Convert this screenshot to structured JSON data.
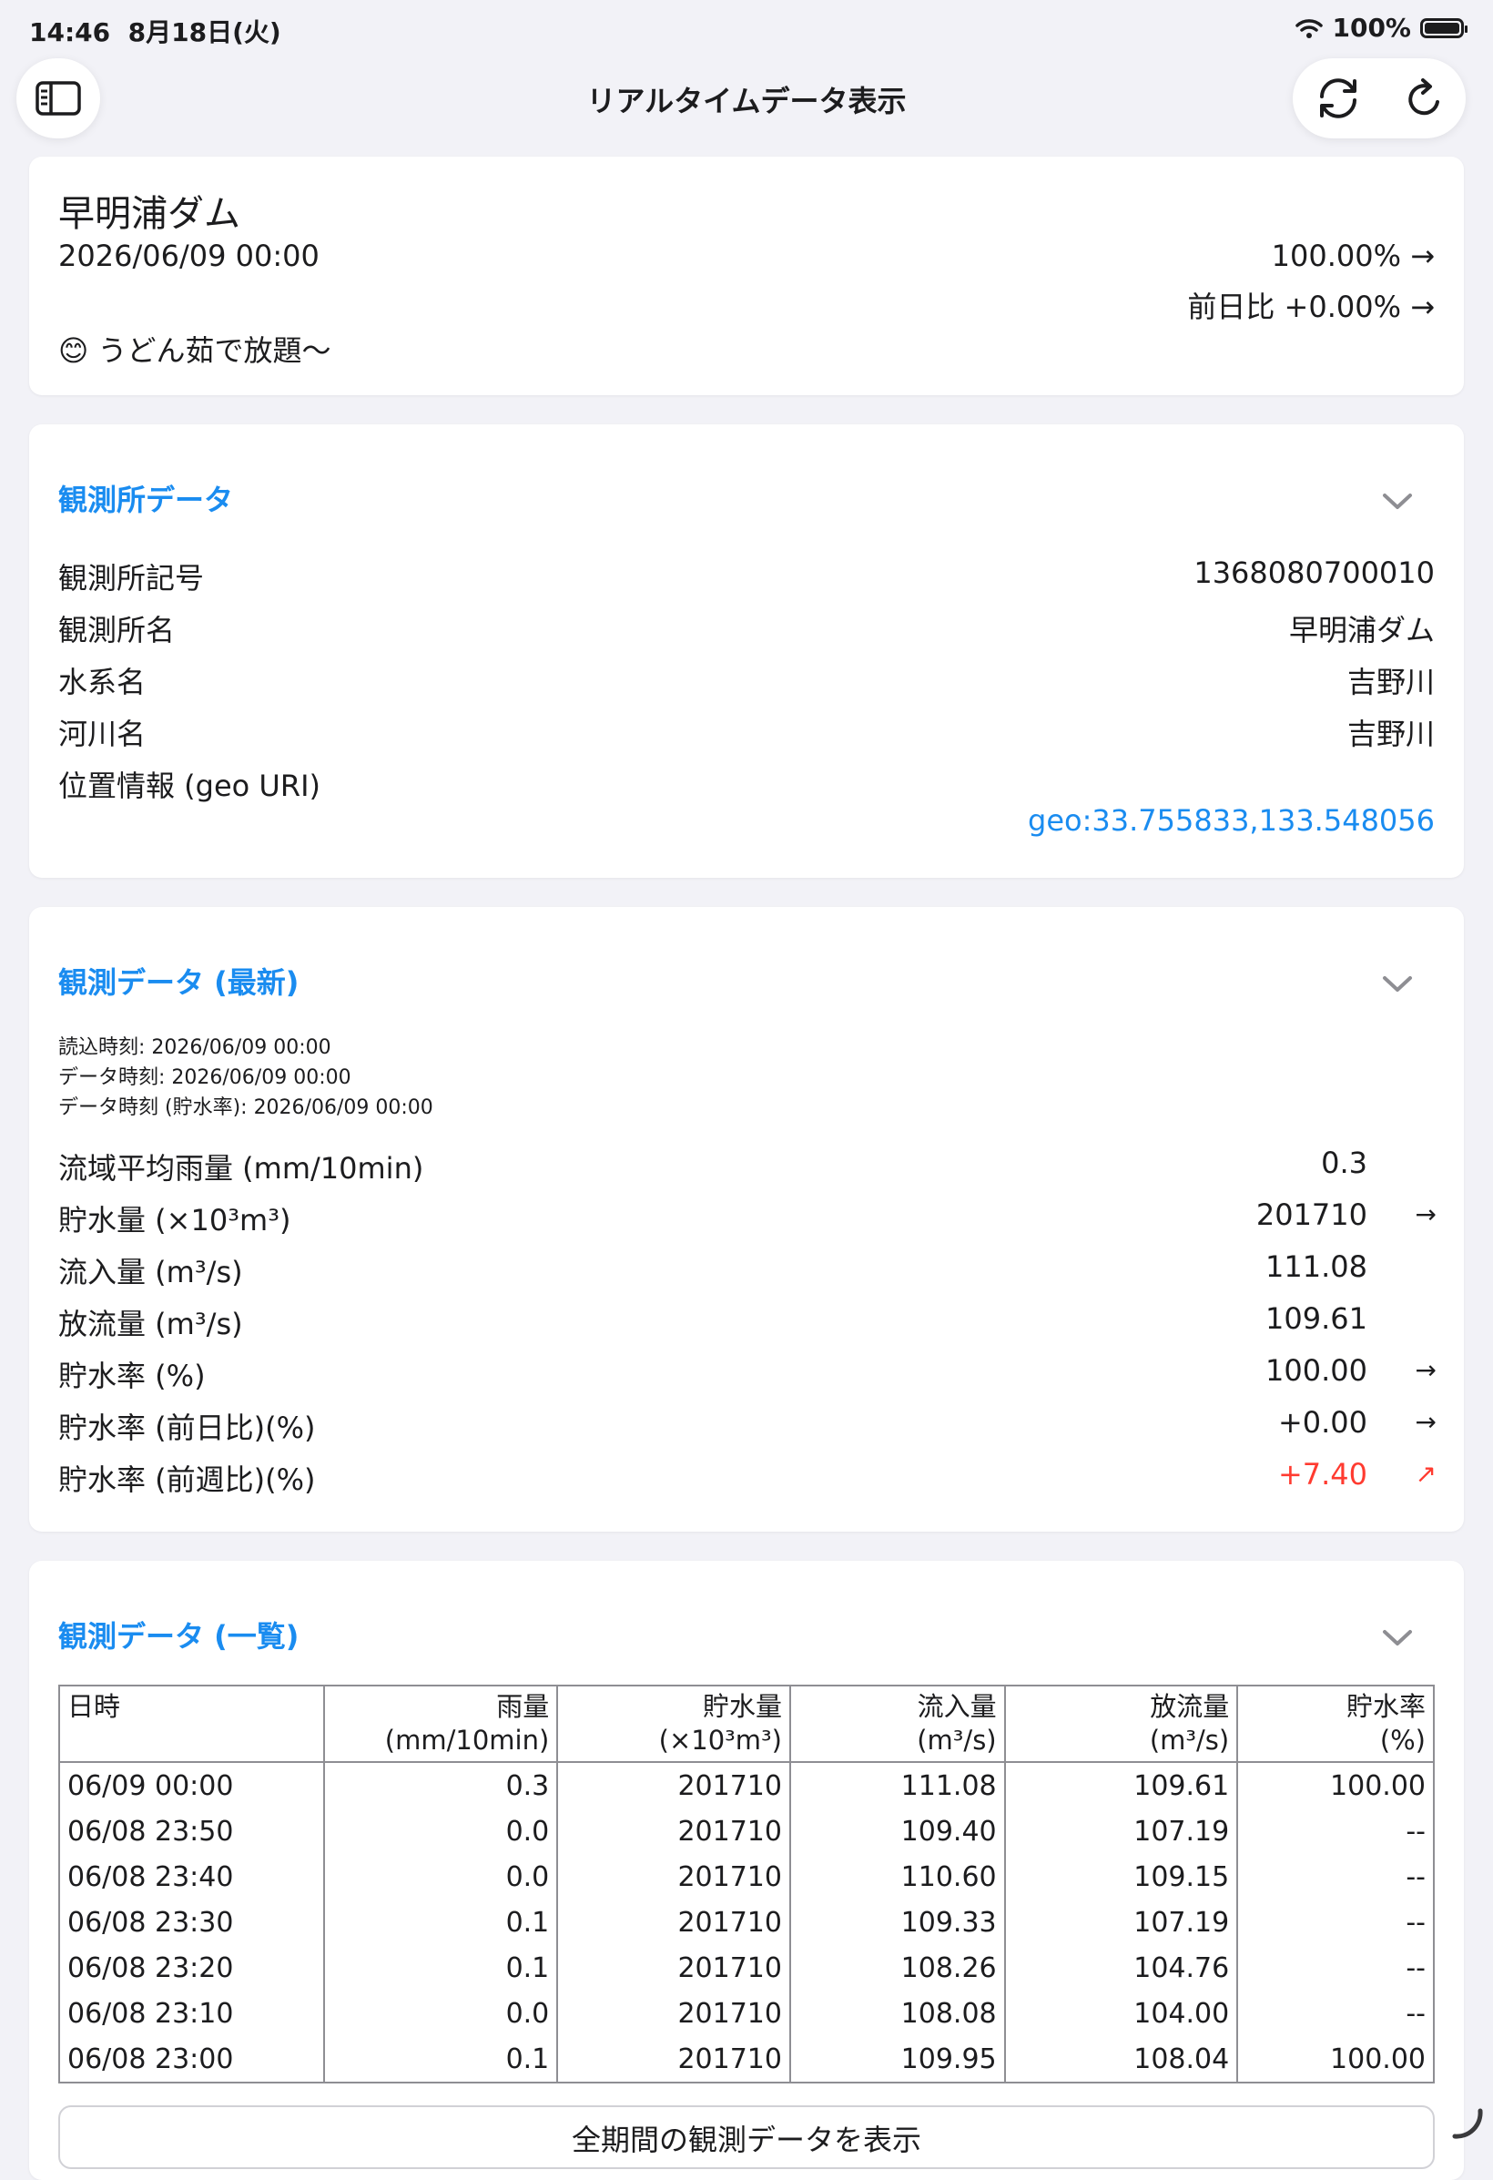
{
  "status": {
    "time": "14:46",
    "date": "8月18日(火)",
    "battery": "100%"
  },
  "nav": {
    "title": "リアルタイムデータ表示"
  },
  "summary": {
    "name": "早明浦ダム",
    "datetime": "2026/06/09 00:00",
    "rate": "100.00%",
    "rate_arrow": "→",
    "diff": "前日比 +0.00%",
    "diff_arrow": "→",
    "emoji": "😊",
    "comment": "うどん茹で放題〜"
  },
  "station": {
    "title": "観測所データ",
    "rows": [
      {
        "label": "観測所記号",
        "value": "1368080700010"
      },
      {
        "label": "観測所名",
        "value": "早明浦ダム"
      },
      {
        "label": "水系名",
        "value": "吉野川"
      },
      {
        "label": "河川名",
        "value": "吉野川"
      }
    ],
    "geo_label": "位置情報 (geo URI)",
    "geo_value": "geo:33.755833,133.548056",
    "link_color": "#1a8cf0"
  },
  "latest": {
    "title": "観測データ (最新)",
    "read_time": "読込時刻: 2026/06/09 00:00",
    "data_time": "データ時刻: 2026/06/09 00:00",
    "data_time_rate": "データ時刻 (貯水率): 2026/06/09 00:00",
    "rows": [
      {
        "label": "流域平均雨量 (mm/10min)",
        "value": "0.3",
        "arrow": ""
      },
      {
        "label": "貯水量 (×10³m³)",
        "value": "201710",
        "arrow": "→"
      },
      {
        "label": "流入量 (m³/s)",
        "value": "111.08",
        "arrow": ""
      },
      {
        "label": "放流量 (m³/s)",
        "value": "109.61",
        "arrow": ""
      },
      {
        "label": "貯水率 (%)",
        "value": "100.00",
        "arrow": "→"
      },
      {
        "label": "貯水率 (前日比)(%)",
        "value": "+0.00",
        "arrow": "→"
      },
      {
        "label": "貯水率 (前週比)(%)",
        "value": "+7.40",
        "arrow": "↗"
      }
    ],
    "up_color": "#ff3b30"
  },
  "list": {
    "title": "観測データ (一覧)",
    "headers": [
      [
        "日時",
        ""
      ],
      [
        "雨量",
        "(mm/10min)"
      ],
      [
        "貯水量",
        "(×10³m³)"
      ],
      [
        "流入量",
        "(m³/s)"
      ],
      [
        "放流量",
        "(m³/s)"
      ],
      [
        "貯水率",
        "(%)"
      ]
    ],
    "rows": [
      [
        "06/09 00:00",
        "0.3",
        "201710",
        "111.08",
        "109.61",
        "100.00"
      ],
      [
        "06/08 23:50",
        "0.0",
        "201710",
        "109.40",
        "107.19",
        "--"
      ],
      [
        "06/08 23:40",
        "0.0",
        "201710",
        "110.60",
        "109.15",
        "--"
      ],
      [
        "06/08 23:30",
        "0.1",
        "201710",
        "109.33",
        "107.19",
        "--"
      ],
      [
        "06/08 23:20",
        "0.1",
        "201710",
        "108.26",
        "104.76",
        "--"
      ],
      [
        "06/08 23:10",
        "0.0",
        "201710",
        "108.08",
        "104.00",
        "--"
      ],
      [
        "06/08 23:00",
        "0.1",
        "201710",
        "109.95",
        "108.04",
        "100.00"
      ]
    ],
    "button": "全期間の観測データを表示"
  }
}
